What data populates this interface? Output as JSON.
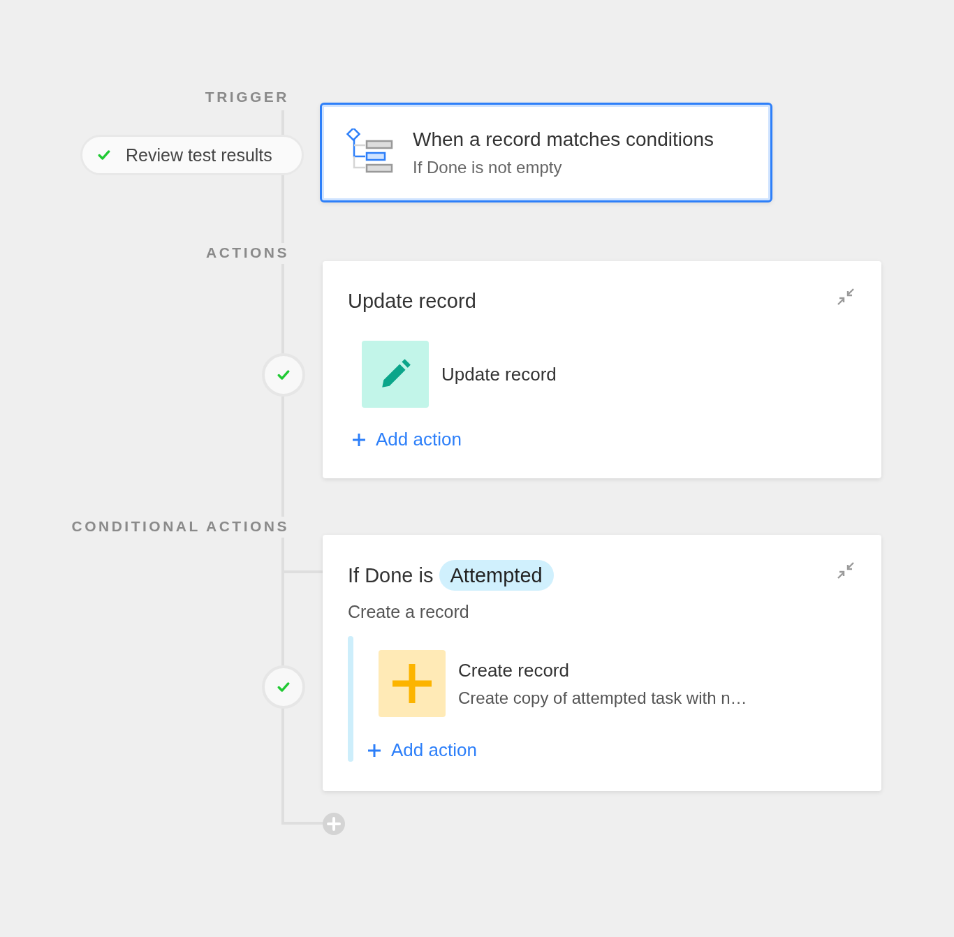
{
  "trigger": {
    "label": "TRIGGER",
    "test_status": {
      "label": "Review test results",
      "passed": true
    },
    "card": {
      "title": "When a record matches conditions",
      "subtitle": "If Done is not empty",
      "selected": true
    }
  },
  "actions": {
    "label": "ACTIONS",
    "step_passed": true,
    "card": {
      "title": "Update record",
      "items": [
        {
          "kind": "update",
          "title": "Update record"
        }
      ],
      "add_label": "Add action"
    }
  },
  "conditional_actions": {
    "label": "CONDITIONAL ACTIONS",
    "step_passed": true,
    "card": {
      "condition_prefix": "If Done is",
      "condition_value": "Attempted",
      "group_label": "Create a record",
      "items": [
        {
          "kind": "create",
          "title": "Create record",
          "description": "Create copy of attempted task with n…"
        }
      ],
      "add_label": "Add action"
    }
  }
}
